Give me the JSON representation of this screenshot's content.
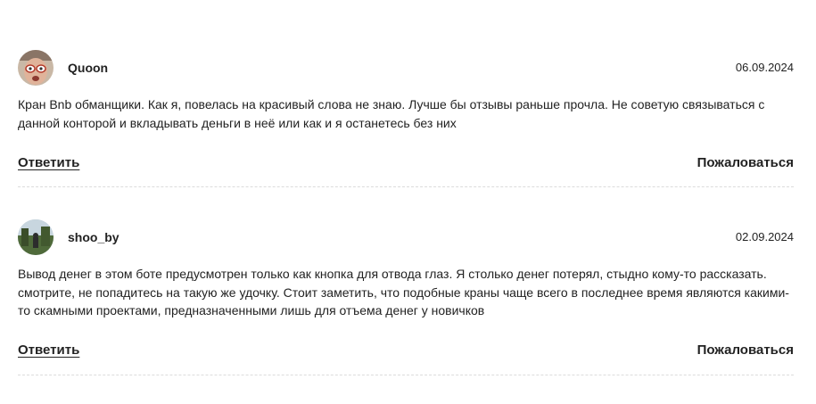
{
  "comments": [
    {
      "author": "Quoon",
      "date": "06.09.2024",
      "text": "Кран Bnb обманщики. Как я, повелась на красивый слова не знаю. Лучше бы отзывы раньше прочла. Не советую связываться с данной конторой и вкладывать деньги в неё или как и я останетесь без них",
      "reply_label": "Ответить",
      "report_label": "Пожаловаться"
    },
    {
      "author": "shoo_by",
      "date": "02.09.2024",
      "text": "Вывод денег в этом боте предусмотрен только как кнопка для отвода глаз. Я столько денег потерял, стыдно кому-то рассказать. смотрите, не попадитесь на такую же удочку. Стоит заметить, что подобные краны чаще всего в последнее время являются какими-то скамными проектами, предназначенными лишь для отъема денег у новичков",
      "reply_label": "Ответить",
      "report_label": "Пожаловаться"
    }
  ]
}
